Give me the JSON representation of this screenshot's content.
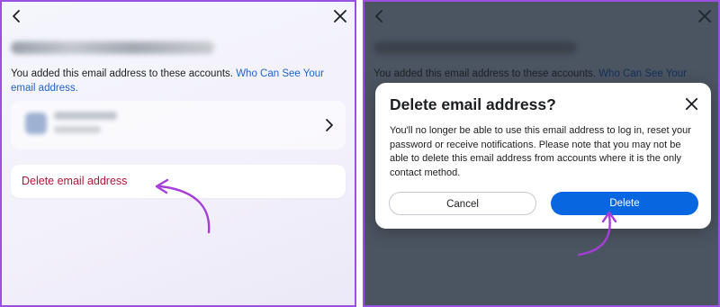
{
  "left": {
    "info_text": "You added this email address to these accounts. ",
    "info_link": "Who Can See Your email address.",
    "delete_label": "Delete email address"
  },
  "right": {
    "background_text": "You added this email address to these accounts. ",
    "background_link": "Who Can See Your",
    "dialog": {
      "title": "Delete email address?",
      "body": "You'll no longer be able to use this email address to log in, reset your password or receive notifications. Please note that you may not be able to delete this email address from accounts where it is the only contact method.",
      "cancel_label": "Cancel",
      "delete_label": "Delete"
    }
  },
  "colors": {
    "border": "#9b51e0",
    "link": "#1f63c6",
    "danger": "#b3163c",
    "primary": "#0866e0",
    "overlay": "#4b5461",
    "arrow": "#a73dd9"
  },
  "icons": [
    "back-chevron-icon",
    "close-icon",
    "chevron-right-icon"
  ]
}
